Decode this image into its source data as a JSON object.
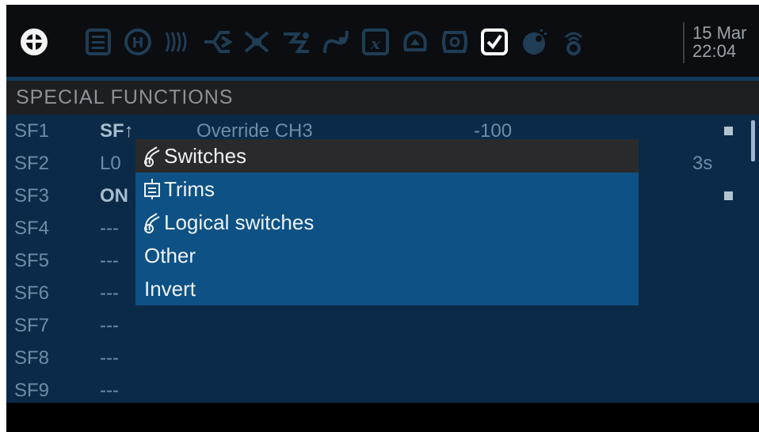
{
  "header": {
    "title": "SPECIAL FUNCTIONS"
  },
  "toolbar": {
    "icons": [
      "radio-menu-icon",
      "model-list-icon",
      "heli-icon",
      "flight-modes-icon",
      "inputs-icon",
      "mixes-icon",
      "outputs-icon",
      "curves-icon",
      "logical-switches-icon",
      "special-functions-icon",
      "telemetry-icon",
      "checklist-icon",
      "timer-icon",
      "wireless-icon"
    ],
    "date": "15 Mar",
    "time": "22:04"
  },
  "list": {
    "rows": [
      {
        "id": "SF1",
        "switch": "SF↑",
        "function": "Override CH3",
        "value": "-100",
        "repeat": "",
        "enabled": true
      },
      {
        "id": "SF2",
        "switch": "L0",
        "function": "",
        "value": "",
        "repeat": "3s",
        "enabled": false
      },
      {
        "id": "SF3",
        "switch": "ON",
        "function": "",
        "value": "",
        "repeat": "",
        "enabled": true
      },
      {
        "id": "SF4",
        "switch": "---",
        "function": "",
        "value": "",
        "repeat": "",
        "enabled": false
      },
      {
        "id": "SF5",
        "switch": "---",
        "function": "",
        "value": "",
        "repeat": "",
        "enabled": false
      },
      {
        "id": "SF6",
        "switch": "---",
        "function": "",
        "value": "",
        "repeat": "",
        "enabled": false
      },
      {
        "id": "SF7",
        "switch": "---",
        "function": "",
        "value": "",
        "repeat": "",
        "enabled": false
      },
      {
        "id": "SF8",
        "switch": "---",
        "function": "",
        "value": "",
        "repeat": "",
        "enabled": false
      },
      {
        "id": "SF9",
        "switch": "---",
        "function": "",
        "value": "",
        "repeat": "",
        "enabled": false
      }
    ]
  },
  "popup": {
    "items": [
      {
        "label": "Switches",
        "icon": "switch-icon",
        "selected": true
      },
      {
        "label": "Trims",
        "icon": "trim-icon",
        "selected": false
      },
      {
        "label": "Logical switches",
        "icon": "switch-icon",
        "selected": false
      },
      {
        "label": "Other",
        "icon": "",
        "selected": false
      },
      {
        "label": "Invert",
        "icon": "",
        "selected": false
      }
    ]
  },
  "colors": {
    "list_bg": "#0a2a48",
    "popup_bg": "#0d5185",
    "popup_selected": "#2a2a2c",
    "icon_inactive": "#1f3d55",
    "icon_active": "#ffffff"
  }
}
